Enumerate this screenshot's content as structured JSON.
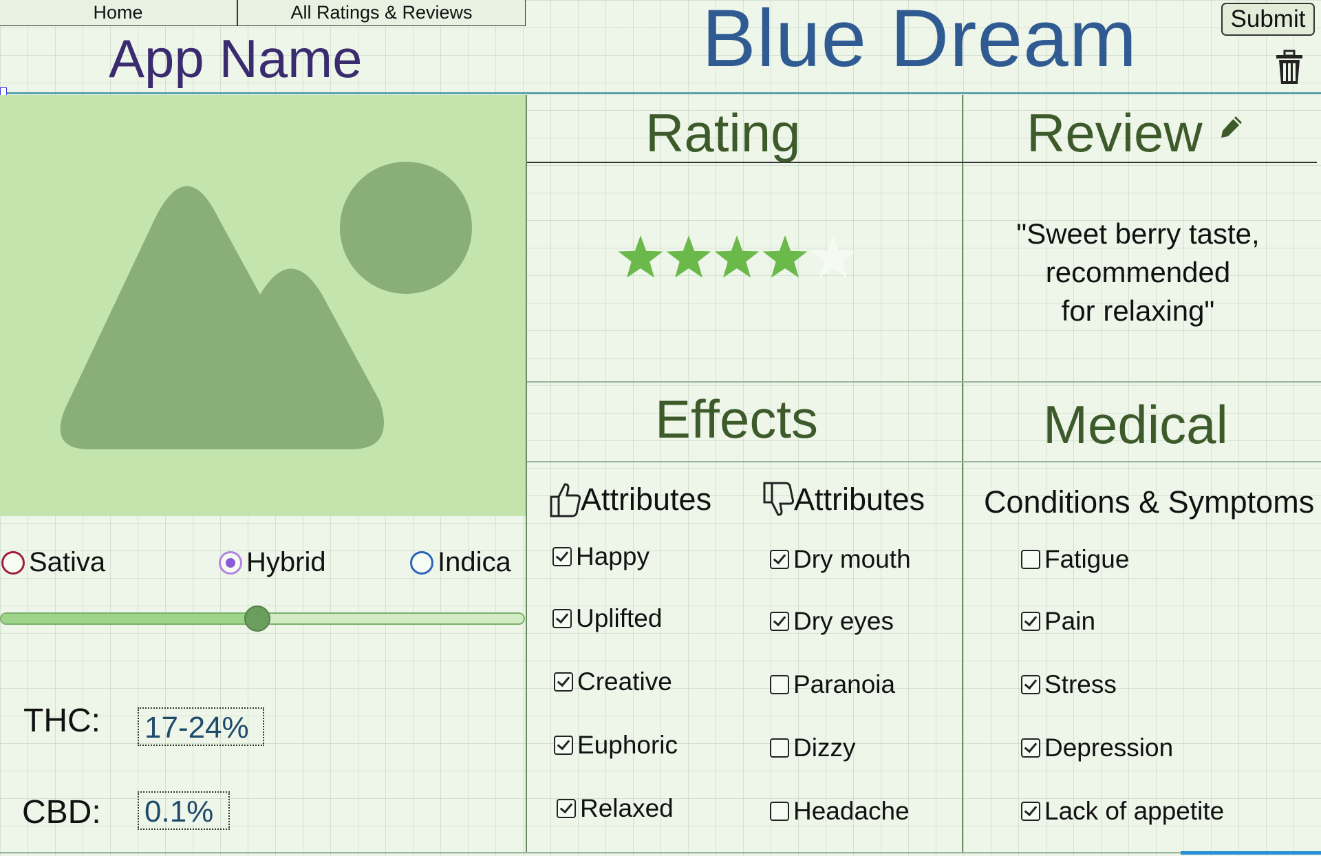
{
  "nav": {
    "home": "Home",
    "all_reviews": "All Ratings & Reviews"
  },
  "app_name": "App Name",
  "strain_name": "Blue Dream",
  "submit_label": "Submit",
  "strain_type": {
    "options": [
      "Sativa",
      "Hybrid",
      "Indica"
    ],
    "selected": "Hybrid"
  },
  "sativa_indica_slider": {
    "value_percent": 49
  },
  "thc": {
    "label": "THC:",
    "value": "17-24%"
  },
  "cbd": {
    "label": "CBD:",
    "value": "0.1%"
  },
  "rating": {
    "title": "Rating",
    "stars_filled": 4,
    "stars_total": 5
  },
  "review": {
    "title": "Review",
    "text_lines": [
      "\"Sweet berry taste,",
      "recommended",
      "for relaxing\""
    ]
  },
  "effects": {
    "title": "Effects",
    "positive_header": "Attributes",
    "negative_header": "Attributes",
    "positive": [
      {
        "label": "Happy",
        "checked": true
      },
      {
        "label": "Uplifted",
        "checked": true
      },
      {
        "label": "Creative",
        "checked": true
      },
      {
        "label": "Euphoric",
        "checked": true
      },
      {
        "label": "Relaxed",
        "checked": true
      }
    ],
    "negative": [
      {
        "label": "Dry mouth",
        "checked": true
      },
      {
        "label": "Dry eyes",
        "checked": true
      },
      {
        "label": "Paranoia",
        "checked": false
      },
      {
        "label": "Dizzy",
        "checked": false
      },
      {
        "label": "Headache",
        "checked": false
      }
    ]
  },
  "medical": {
    "title": "Medical",
    "header": "Conditions & Symptoms",
    "items": [
      {
        "label": "Fatigue",
        "checked": false
      },
      {
        "label": "Pain",
        "checked": true
      },
      {
        "label": "Stress",
        "checked": true
      },
      {
        "label": "Depression",
        "checked": true
      },
      {
        "label": "Lack of appetite",
        "checked": true
      }
    ]
  },
  "colors": {
    "star_filled": "#6ab94a",
    "star_empty": "#f5fbf3",
    "title_blue": "#2f5b92",
    "app_name_purple": "#3a2a6e",
    "section_green": "#3d5a2a"
  },
  "icons": [
    "trash-icon",
    "pencil-icon",
    "thumbs-up-icon",
    "thumbs-down-icon",
    "image-placeholder-icon"
  ]
}
